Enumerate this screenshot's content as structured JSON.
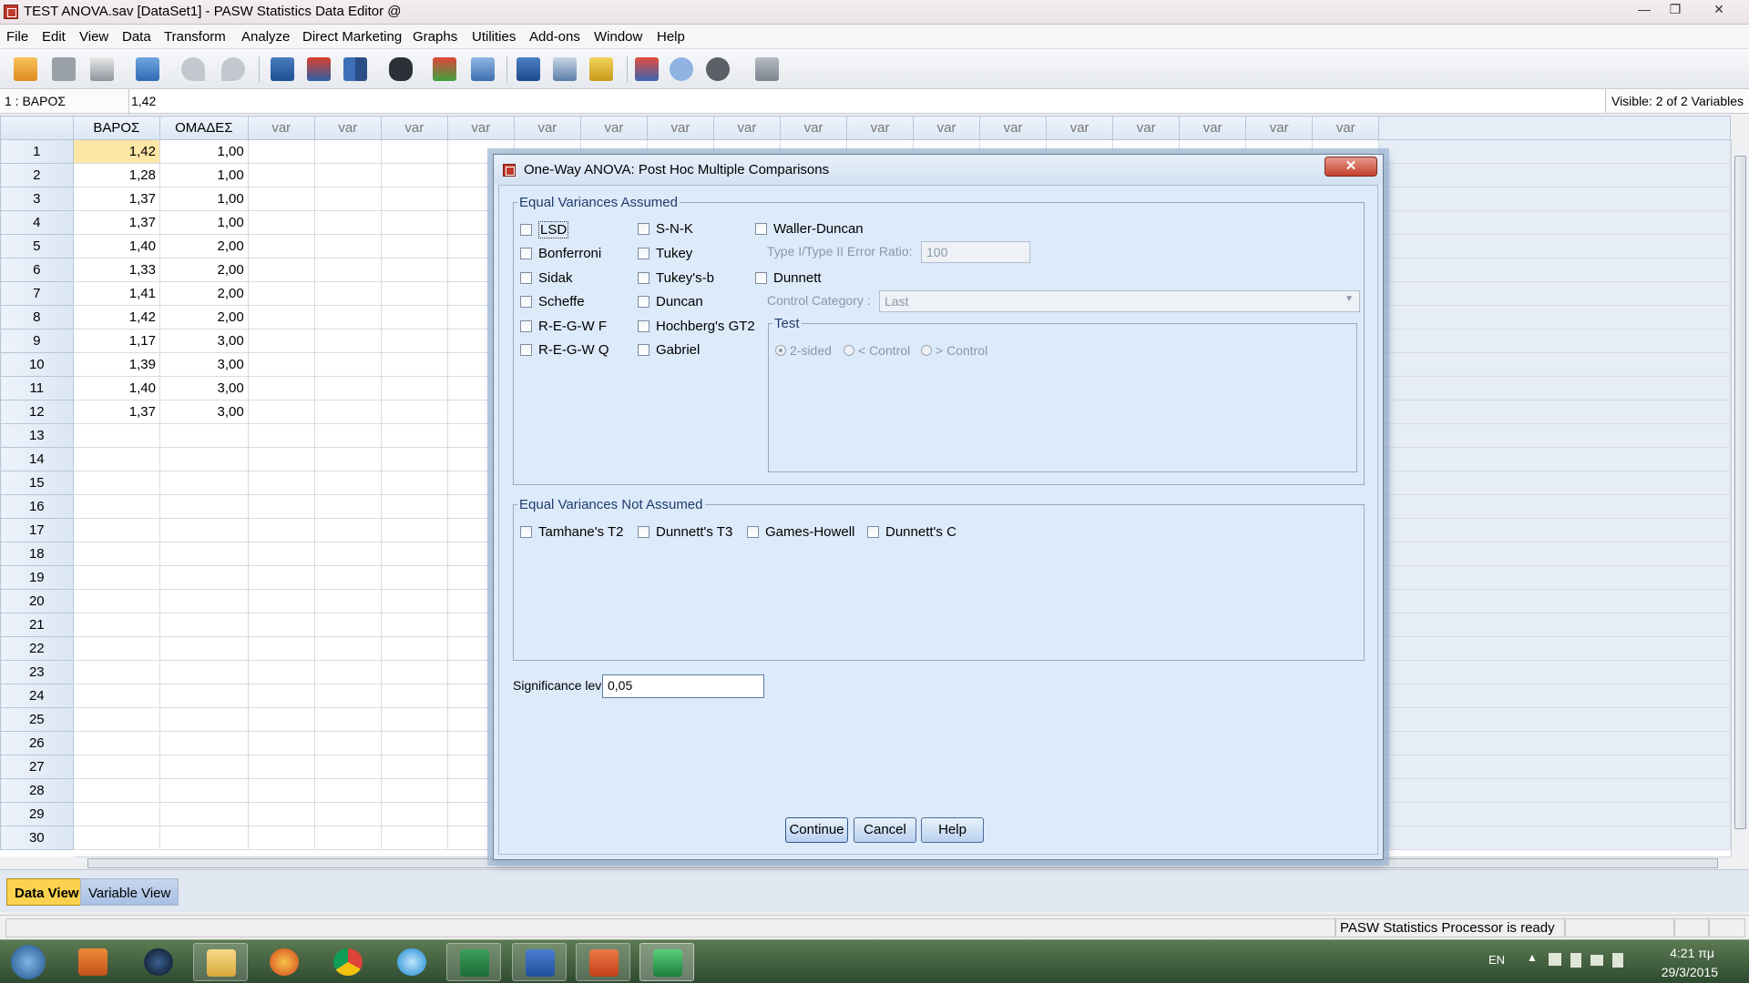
{
  "window": {
    "title": "TEST ANOVA.sav [DataSet1] - PASW Statistics Data Editor @",
    "controls": [
      "—",
      "❐",
      "✕"
    ]
  },
  "menu": [
    "File",
    "Edit",
    "View",
    "Data",
    "Transform",
    "Analyze",
    "Direct Marketing",
    "Graphs",
    "Utilities",
    "Add-ons",
    "Window",
    "Help"
  ],
  "toolbar_icons": [
    "open-icon",
    "save-icon",
    "print-icon",
    "dialog-recall-icon",
    "undo-icon",
    "redo-icon",
    "goto-case-icon",
    "goto-variable-icon",
    "variables-icon",
    "find-icon",
    "insert-cases-icon",
    "insert-variable-icon",
    "split-file-icon",
    "weight-cases-icon",
    "select-cases-icon",
    "value-labels-icon",
    "use-sets-icon",
    "show-all-variables-icon",
    "spell-check-icon"
  ],
  "editor": {
    "cell_ref": "1 : ΒΑΡΟΣ",
    "cell_value": "1,42",
    "visible": "Visible: 2 of 2 Variables"
  },
  "grid": {
    "columns": [
      "ΒΑΡΟΣ",
      "ΟΜΑΔΕΣ",
      "var",
      "var",
      "var",
      "var",
      "var",
      "var",
      "var",
      "var",
      "var",
      "var",
      "var",
      "var",
      "var",
      "var",
      "var",
      "var",
      "var"
    ],
    "rows": [
      [
        "1",
        "1,42",
        "1,00"
      ],
      [
        "2",
        "1,28",
        "1,00"
      ],
      [
        "3",
        "1,37",
        "1,00"
      ],
      [
        "4",
        "1,37",
        "1,00"
      ],
      [
        "5",
        "1,40",
        "2,00"
      ],
      [
        "6",
        "1,33",
        "2,00"
      ],
      [
        "7",
        "1,41",
        "2,00"
      ],
      [
        "8",
        "1,42",
        "2,00"
      ],
      [
        "9",
        "1,17",
        "3,00"
      ],
      [
        "10",
        "1,39",
        "3,00"
      ],
      [
        "11",
        "1,40",
        "3,00"
      ],
      [
        "12",
        "1,37",
        "3,00"
      ],
      [
        "13",
        "",
        ""
      ],
      [
        "14",
        "",
        ""
      ],
      [
        "15",
        "",
        ""
      ],
      [
        "16",
        "",
        ""
      ],
      [
        "17",
        "",
        ""
      ],
      [
        "18",
        "",
        ""
      ],
      [
        "19",
        "",
        ""
      ],
      [
        "20",
        "",
        ""
      ],
      [
        "21",
        "",
        ""
      ],
      [
        "22",
        "",
        ""
      ],
      [
        "23",
        "",
        ""
      ],
      [
        "24",
        "",
        ""
      ],
      [
        "25",
        "",
        ""
      ],
      [
        "26",
        "",
        ""
      ],
      [
        "27",
        "",
        ""
      ],
      [
        "28",
        "",
        ""
      ],
      [
        "29",
        "",
        ""
      ],
      [
        "30",
        "",
        ""
      ]
    ]
  },
  "tabs": {
    "data_view": "Data View",
    "variable_view": "Variable View"
  },
  "status": {
    "processor": "PASW Statistics Processor is ready"
  },
  "taskbar": {
    "apps": [
      "start-orb-icon",
      "media-player-icon",
      "media-center-icon",
      "explorer-icon",
      "firefox-icon",
      "chrome-icon",
      "internet-explorer-icon",
      "excel-icon",
      "word-icon",
      "powerpoint-icon",
      "pasw-icon"
    ],
    "lang": "EN",
    "time": "4:21 πμ",
    "date": "29/3/2015"
  },
  "dialog": {
    "title": "One-Way ANOVA: Post Hoc Multiple Comparisons",
    "close": "✕",
    "equal_assumed": {
      "legend": "Equal Variances Assumed",
      "col1": [
        "LSD",
        "Bonferroni",
        "Sidak",
        "Scheffe",
        "R-E-G-W F",
        "R-E-G-W Q"
      ],
      "col2": [
        "S-N-K",
        "Tukey",
        "Tukey's-b",
        "Duncan",
        "Hochberg's GT2",
        "Gabriel"
      ],
      "waller": "Waller-Duncan",
      "ratio_label": "Type I/Type II Error Ratio:",
      "ratio_value": "100",
      "dunnett": "Dunnett",
      "control_label": "Control Category :",
      "control_value": "Last",
      "test": {
        "legend": "Test",
        "options": [
          "2-sided",
          "< Control",
          "> Control"
        ],
        "selected": "2-sided"
      }
    },
    "equal_not_assumed": {
      "legend": "Equal Variances Not Assumed",
      "options": [
        "Tamhane's T2",
        "Dunnett's T3",
        "Games-Howell",
        "Dunnett's C"
      ]
    },
    "significance": {
      "label": "Significance level:",
      "value": "0,05"
    },
    "buttons": {
      "continue": "Continue",
      "cancel": "Cancel",
      "help": "Help"
    }
  },
  "colors": {
    "selected_cell": "#fde6a6",
    "dialog_bg": "#ddeafa",
    "close_button": "#c4412c",
    "legend_text": "#1f3c6b"
  }
}
